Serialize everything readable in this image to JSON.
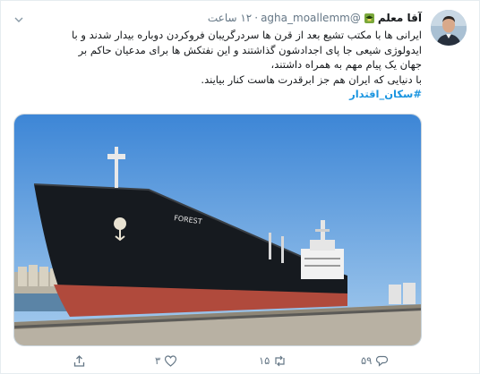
{
  "tweet": {
    "display_name": "آقا معلم",
    "handle": "@agha_moallemm",
    "separator": "·",
    "time": "۱۲ ساعت",
    "lines": [
      "ایرانی ها با مکتب تشیع بعد از قرن ها سردرگریبان فروکردن دوباره بیدار شدند و با",
      "ایدولوژی شیعی جا پای اجداد‌شون گذاشتند و این نفتکش ها برای مدعیان حاکم بر",
      "جهان یک پیام مهم به همراه داشتند،",
      "با دنیایی که ایران هم جز ابرقدرت هاست کنار بیایند."
    ],
    "hashtag": "#سکان_اقتدار",
    "ship_name": "FOREST"
  },
  "actions": {
    "reply_count": "۵۹",
    "retweet_count": "۱۵",
    "like_count": "۳"
  },
  "icons": {
    "badge": "graduation-badge-icon",
    "chevron": "chevron-down-icon",
    "share": "share-icon",
    "reply": "reply-icon",
    "retweet": "retweet-icon",
    "like": "heart-icon"
  },
  "colors": {
    "link": "#1b95e0",
    "muted": "#657786",
    "text": "#14171a",
    "border": "#e6ecf0"
  }
}
